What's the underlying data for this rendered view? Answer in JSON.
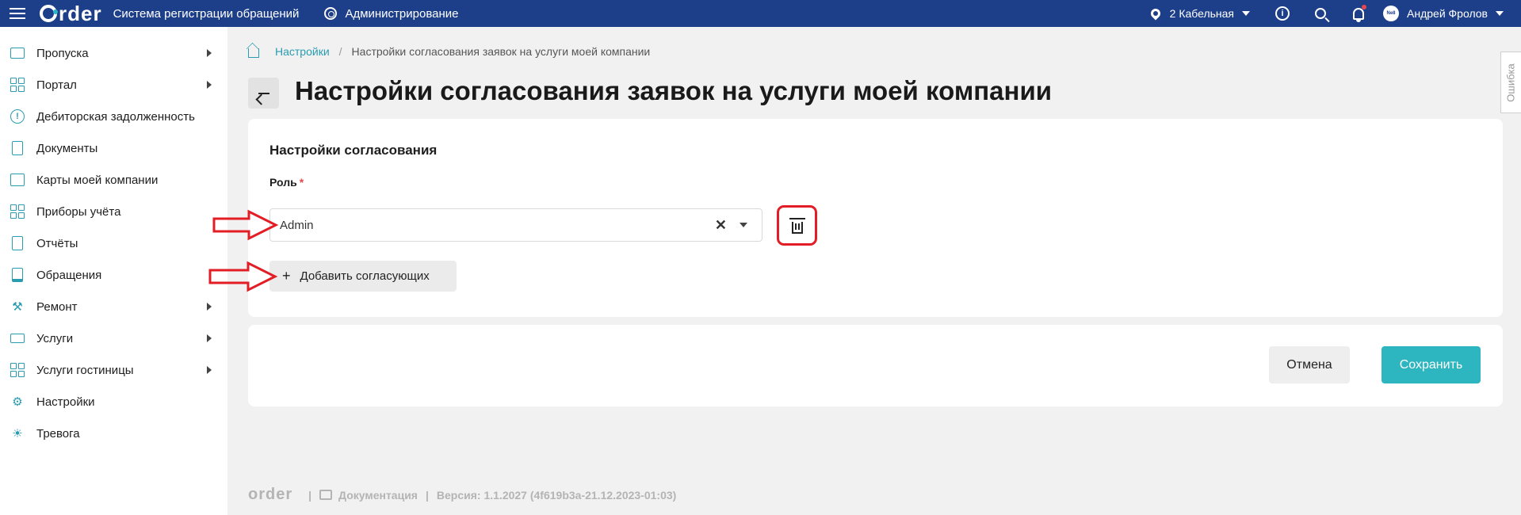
{
  "header": {
    "logo_text": "rder",
    "app_title": "Система регистрации обращений",
    "admin_label": "Администрирование",
    "location": "2 Кабельная",
    "user_name": "Андрей Фролов",
    "avatar_text": "Ne8"
  },
  "sidebar": {
    "items": [
      {
        "label": "Пропуска",
        "icon": "pass-card-icon",
        "has_submenu": true
      },
      {
        "label": "Портал",
        "icon": "grid-icon",
        "has_submenu": true
      },
      {
        "label": "Дебиторская задолженность",
        "icon": "alert-circle-icon",
        "has_submenu": false
      },
      {
        "label": "Документы",
        "icon": "document-icon",
        "has_submenu": false
      },
      {
        "label": "Карты моей компании",
        "icon": "map-icon",
        "has_submenu": false
      },
      {
        "label": "Приборы учёта",
        "icon": "meter-icon",
        "has_submenu": false
      },
      {
        "label": "Отчёты",
        "icon": "report-icon",
        "has_submenu": false
      },
      {
        "label": "Обращения",
        "icon": "book-icon",
        "has_submenu": false
      },
      {
        "label": "Ремонт",
        "icon": "wrench-icon",
        "has_submenu": true
      },
      {
        "label": "Услуги",
        "icon": "briefcase-icon",
        "has_submenu": true
      },
      {
        "label": "Услуги гостиницы",
        "icon": "hotel-icon",
        "has_submenu": true
      },
      {
        "label": "Настройки",
        "icon": "gear-icon",
        "has_submenu": false
      },
      {
        "label": "Тревога",
        "icon": "alarm-icon",
        "has_submenu": false
      }
    ]
  },
  "breadcrumb": {
    "link": "Настройки",
    "current": "Настройки согласования заявок на услуги моей компании"
  },
  "page": {
    "title": "Настройки согласования заявок на услуги моей компании"
  },
  "form": {
    "section_title": "Настройки согласования",
    "role_label": "Роль",
    "required_mark": "*",
    "role_value": "Admin",
    "add_button": "Добавить согласующих"
  },
  "actions": {
    "cancel": "Отмена",
    "save": "Сохранить"
  },
  "footer": {
    "logo_text": "order",
    "docs_label": "Документация",
    "version": "Версия: 1.1.2027 (4f619b3a-21.12.2023-01:03)"
  },
  "side_tab": {
    "label": "Ошибка"
  },
  "colors": {
    "header_bg": "#1d3f8a",
    "accent": "#2a9cb0",
    "save_bg": "#2db6c0",
    "annotation_red": "#e21d25"
  }
}
